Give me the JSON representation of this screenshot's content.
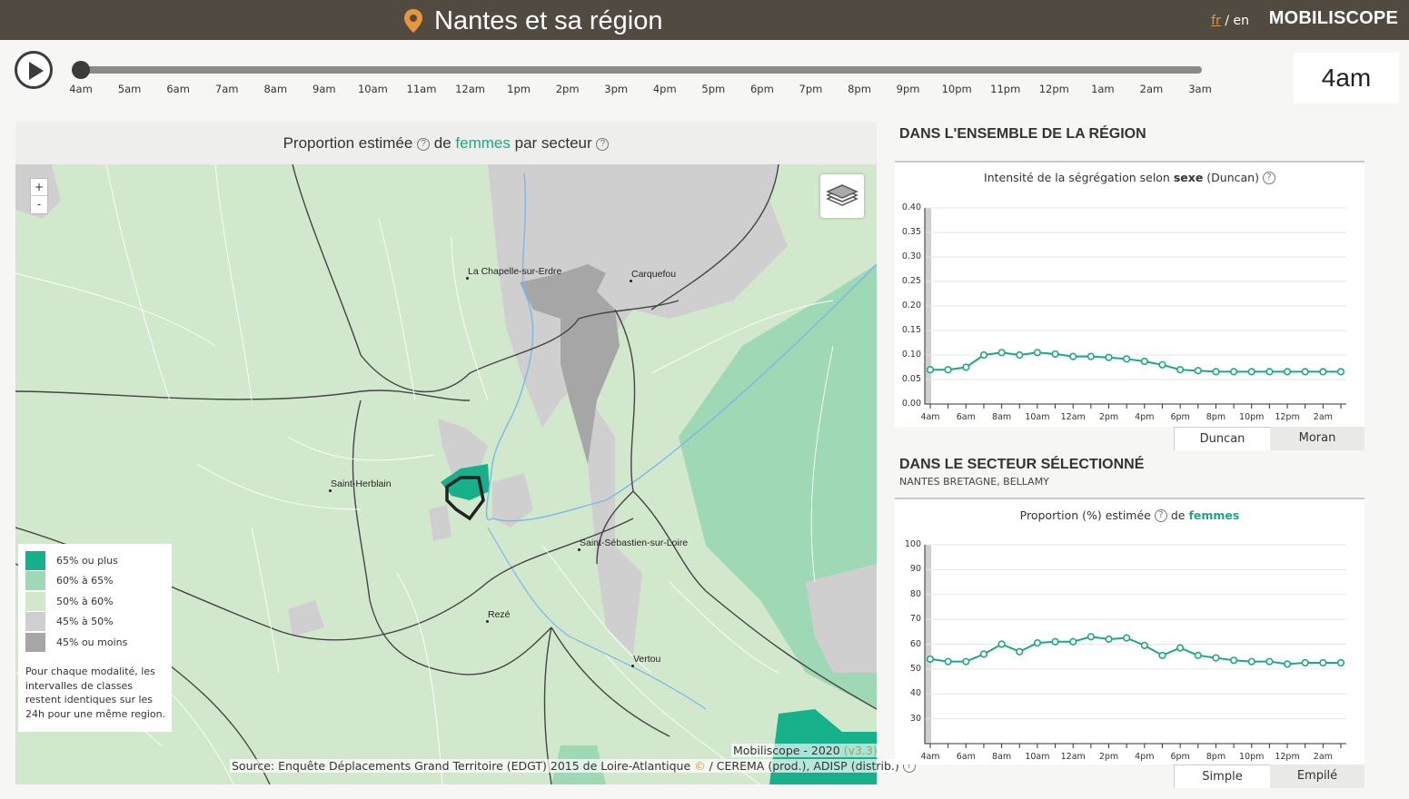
{
  "header": {
    "title": "Nantes et sa région",
    "lang_fr": "fr",
    "lang_sep": "/",
    "lang_en": "en",
    "brand": "MOBILISCOPE",
    "pin_color": "#e8963a"
  },
  "timeline": {
    "hours": [
      "4am",
      "5am",
      "6am",
      "7am",
      "8am",
      "9am",
      "10am",
      "11am",
      "12am",
      "1pm",
      "2pm",
      "3pm",
      "4pm",
      "5pm",
      "6pm",
      "7pm",
      "8pm",
      "9pm",
      "10pm",
      "11pm",
      "12pm",
      "1am",
      "2am",
      "3am"
    ],
    "current": "4am",
    "position": 0
  },
  "map": {
    "title_a": "Proportion estimée",
    "title_b": "de",
    "title_hl": "femmes",
    "title_c": "par secteur",
    "zoom_in": "+",
    "zoom_out": "-",
    "cities": [
      "La Chapelle-sur-Erdre",
      "Carquefou",
      "Saint-Herblain",
      "Saint-Sébastien-sur-Loire",
      "Rezé",
      "Vertou"
    ],
    "legend": [
      {
        "label": "65% ou plus",
        "color": "#16b08a"
      },
      {
        "label": "60% à 65%",
        "color": "#9fd8b5"
      },
      {
        "label": "50% à 60%",
        "color": "#d2e8cd"
      },
      {
        "label": "45% à 50%",
        "color": "#cfcfcf"
      },
      {
        "label": "45% ou moins",
        "color": "#a6a6a6"
      }
    ],
    "legend_note": "Pour chaque modalité, les intervalles de classes restent identiques sur les 24h pour une même region.",
    "credit": "Mobiliscope - 2020",
    "version": "(v3.3)",
    "source_a": "Source: Enquête Déplacements Grand Territoire (EDGT) 2015 de Loire-Atlantique",
    "source_c": "©",
    "source_b": "/ CEREMA (prod.), ADISP (distrib.)"
  },
  "region": {
    "heading": "DANS L'ENSEMBLE DE LA RÉGION",
    "chart_title_a": "Intensité de la ségrégation selon",
    "chart_title_b": "sexe",
    "chart_title_c": "(Duncan)",
    "tab_1": "Duncan",
    "tab_2": "Moran"
  },
  "sector": {
    "heading": "DANS LE SECTEUR SÉLECTIONNÉ",
    "subheading": "NANTES BRETAGNE, BELLAMY",
    "chart_title_a": "Proportion (%) estimée",
    "chart_title_b": "de",
    "chart_title_hl": "femmes",
    "tab_1": "Simple",
    "tab_2": "Empilé"
  },
  "chart_data": [
    {
      "type": "line",
      "title": "Intensité de la ségrégation selon sexe (Duncan)",
      "x": [
        "4am",
        "5am",
        "6am",
        "7am",
        "8am",
        "9am",
        "10am",
        "11am",
        "12am",
        "1pm",
        "2pm",
        "3pm",
        "4pm",
        "5pm",
        "6pm",
        "7pm",
        "8pm",
        "9pm",
        "10pm",
        "11pm",
        "12pm",
        "1am",
        "2am",
        "3am"
      ],
      "xticks": [
        "4am",
        "6am",
        "8am",
        "10am",
        "12am",
        "2pm",
        "4pm",
        "6pm",
        "8pm",
        "10pm",
        "12pm",
        "2am"
      ],
      "yticks": [
        "0.00",
        "0.05",
        "0.10",
        "0.15",
        "0.20",
        "0.25",
        "0.30",
        "0.35",
        "0.40"
      ],
      "series": [
        {
          "values": [
            0.07,
            0.07,
            0.075,
            0.1,
            0.105,
            0.1,
            0.105,
            0.102,
            0.097,
            0.097,
            0.095,
            0.092,
            0.087,
            0.08,
            0.07,
            0.068,
            0.066,
            0.066,
            0.066,
            0.066,
            0.066,
            0.066,
            0.066,
            0.066
          ]
        }
      ],
      "ylim": [
        0,
        0.4
      ],
      "color": "#1fa683",
      "grid": true
    },
    {
      "type": "line",
      "title": "Proportion (%) estimée de femmes",
      "x": [
        "4am",
        "5am",
        "6am",
        "7am",
        "8am",
        "9am",
        "10am",
        "11am",
        "12am",
        "1pm",
        "2pm",
        "3pm",
        "4pm",
        "5pm",
        "6pm",
        "7pm",
        "8pm",
        "9pm",
        "10pm",
        "11pm",
        "12pm",
        "1am",
        "2am",
        "3am"
      ],
      "xticks": [
        "4am",
        "6am",
        "8am",
        "10am",
        "12am",
        "2pm",
        "4pm",
        "6pm",
        "8pm",
        "10pm",
        "12pm",
        "2am"
      ],
      "yticks": [
        "30",
        "40",
        "50",
        "60",
        "70",
        "80",
        "90",
        "100"
      ],
      "series": [
        {
          "values": [
            54,
            53,
            53,
            56,
            60,
            57,
            60.5,
            61,
            61,
            63,
            62,
            62.5,
            59.5,
            55.5,
            58.5,
            55.5,
            54.5,
            53.5,
            53,
            53,
            52,
            52.5,
            52.5,
            52.5
          ]
        }
      ],
      "ylim": [
        20,
        100
      ],
      "color": "#1fa683",
      "grid": true
    }
  ]
}
